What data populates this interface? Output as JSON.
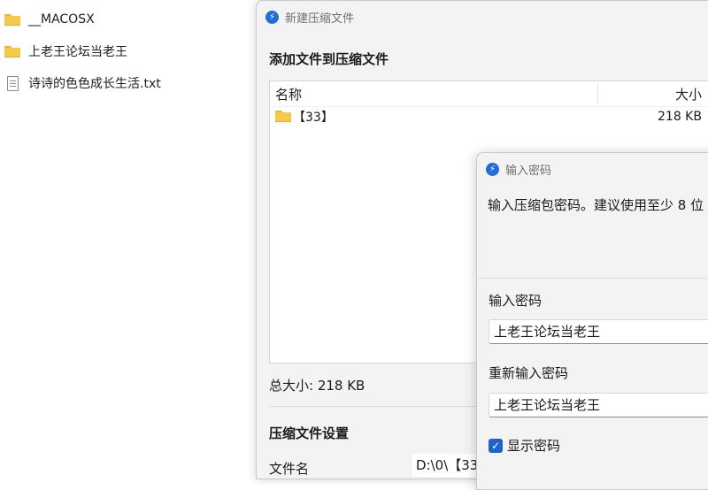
{
  "file_list": {
    "items": [
      {
        "label": "__MACOSX",
        "icon": "folder-icon"
      },
      {
        "label": "上老王论坛当老王",
        "icon": "folder-icon"
      },
      {
        "label": "诗诗的色色成长生活.txt",
        "icon": "text-file-icon"
      }
    ]
  },
  "compress_window": {
    "title": "新建压缩文件",
    "add_files_heading": "添加文件到压缩文件",
    "columns": {
      "name": "名称",
      "size": "大小"
    },
    "rows": [
      {
        "name": "【33】",
        "size": "218 KB",
        "icon": "folder-icon"
      }
    ],
    "total_size": "总大小: 218 KB",
    "settings_heading": "压缩文件设置",
    "filename_label": "文件名",
    "filename_value": "D:\\0\\【33"
  },
  "password_dialog": {
    "title": "输入密码",
    "description": "输入压缩包密码。建议使用至少 8 位",
    "password_label": "输入密码",
    "password_value": "上老王论坛当老王",
    "confirm_label": "重新输入密码",
    "confirm_value": "上老王论坛当老王",
    "show_password_label": "显示密码",
    "show_password_checked": true
  },
  "colors": {
    "accent": "#1f62c9",
    "folder": "#f7c948",
    "window_bg": "#f3f3f3"
  }
}
